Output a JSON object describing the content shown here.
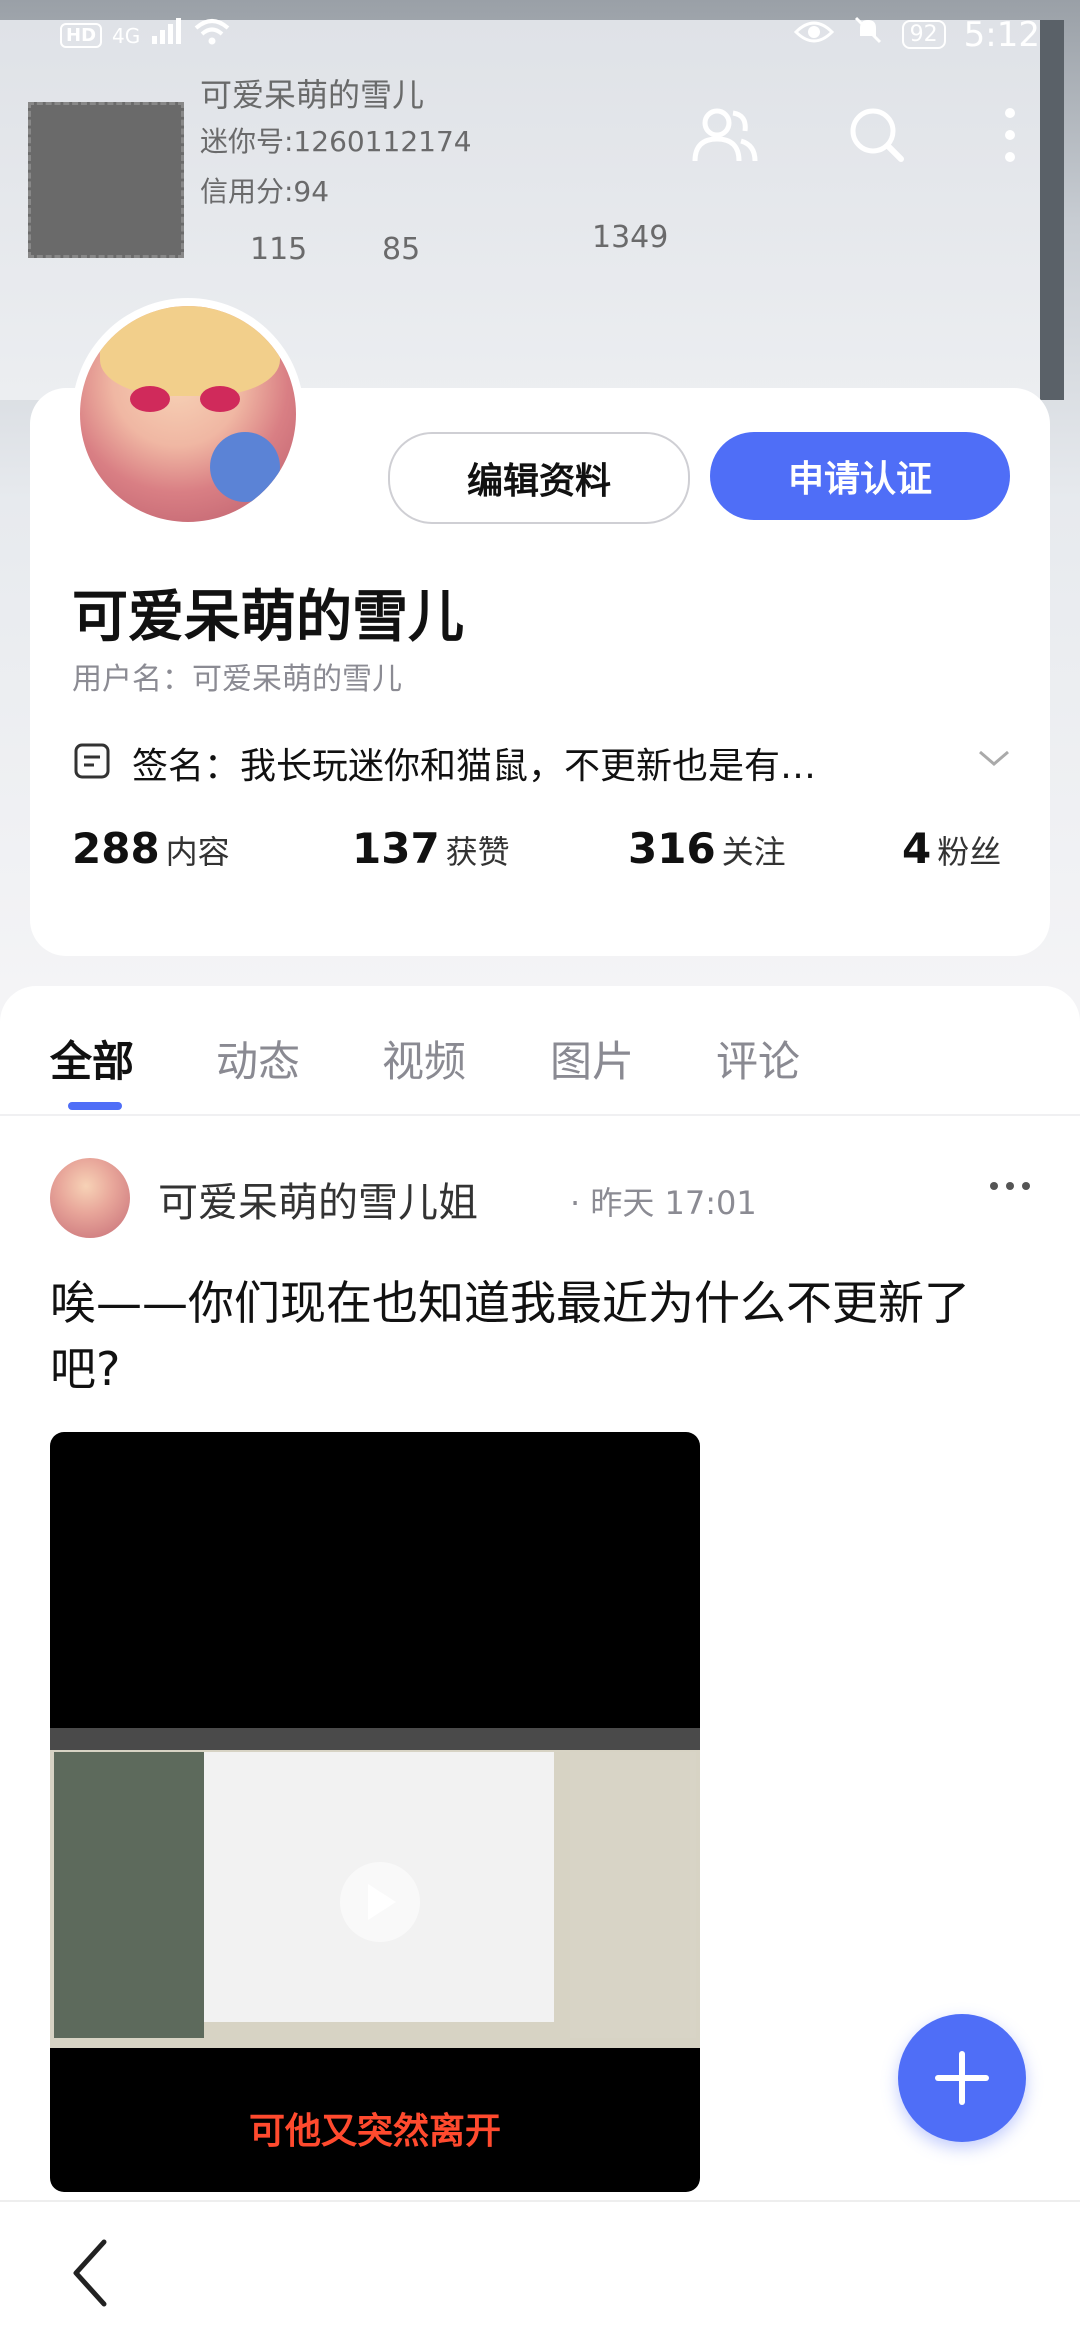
{
  "status_bar": {
    "network_badge": "HD",
    "signal_text": "4G",
    "battery": "92",
    "time": "5:12"
  },
  "background_photo": {
    "name": "可爱呆萌的雪儿",
    "id_line": "迷你号:1260112174",
    "credit_line": "信用分:94",
    "stat_a": "115",
    "stat_b": "85",
    "stat_c": "1349"
  },
  "header": {
    "icons": [
      "friends-icon",
      "search-icon",
      "more-vertical-icon"
    ]
  },
  "profile": {
    "edit_button": "编辑资料",
    "auth_button": "申请认证",
    "display_name": "可爱呆萌的雪儿",
    "username_line": "用户名：可爱呆萌的雪儿",
    "signature": "签名：我长玩迷你和猫鼠，不更新也是有…",
    "stats": [
      {
        "num": "288",
        "label": "内容"
      },
      {
        "num": "137",
        "label": "获赞"
      },
      {
        "num": "316",
        "label": "关注"
      },
      {
        "num": "4",
        "label": "粉丝"
      }
    ]
  },
  "tabs": [
    "全部",
    "动态",
    "视频",
    "图片",
    "评论"
  ],
  "post": {
    "author": "可爱呆萌的雪儿姐",
    "time": "· 昨天 17:01",
    "text": "唉——你们现在也知道我最近为什么不更新了吧?",
    "video_caption": "可他又突然离开"
  },
  "colors": {
    "accent": "#4f6ef7"
  }
}
